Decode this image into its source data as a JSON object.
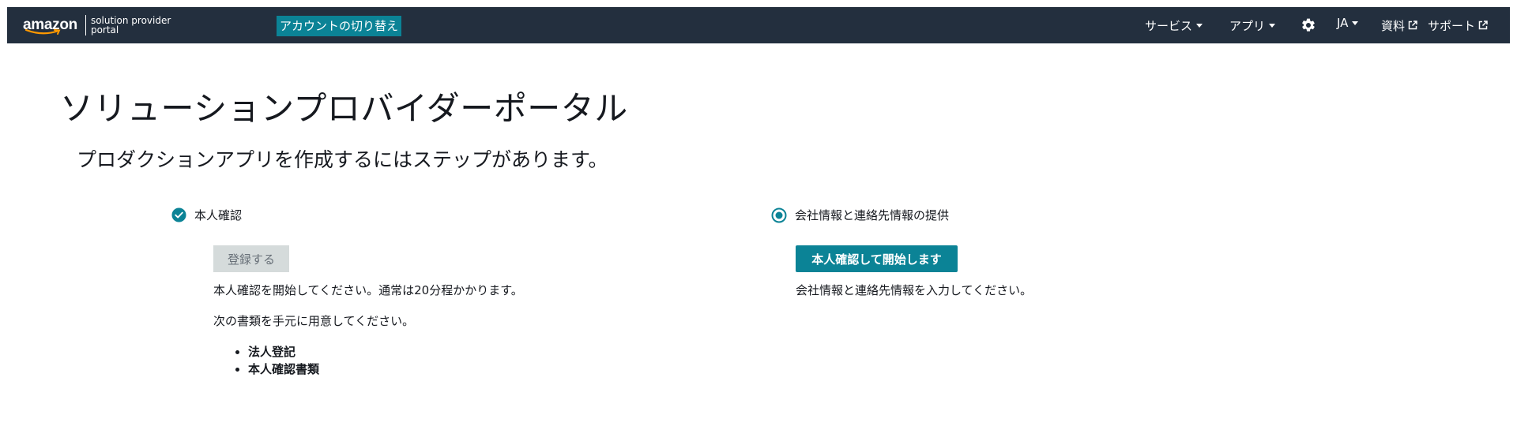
{
  "header": {
    "logo": {
      "brand": "amazon",
      "line1": "solution provider",
      "line2": "portal"
    },
    "switch_account": "アカウントの切り替え",
    "nav": {
      "services": "サービス",
      "apps": "アプリ",
      "settings_icon": "gear-icon",
      "language": "JA",
      "resources": "資料",
      "support": "サポート"
    }
  },
  "main": {
    "title": "ソリューションプロバイダーポータル",
    "subtitle": "プロダクションアプリを作成するにはステップがあります。",
    "steps": [
      {
        "label": "本人確認",
        "status_icon": "check-circle-icon",
        "button": "登録する",
        "description": "本人確認を開始してください。通常は20分程かかります。",
        "docs_intro": "次の書類を手元に用意してください。",
        "docs": [
          "法人登記",
          "本人確認書類"
        ]
      },
      {
        "label": "会社情報と連絡先情報の提供",
        "status_icon": "radio-selected-icon",
        "button": "本人確認して開始します",
        "description": "会社情報と連絡先情報を入力してください。"
      }
    ]
  },
  "colors": {
    "header_bg": "#232f3e",
    "accent": "#0b8396",
    "disabled_bg": "#d5dbdb",
    "text": "#16191f"
  }
}
